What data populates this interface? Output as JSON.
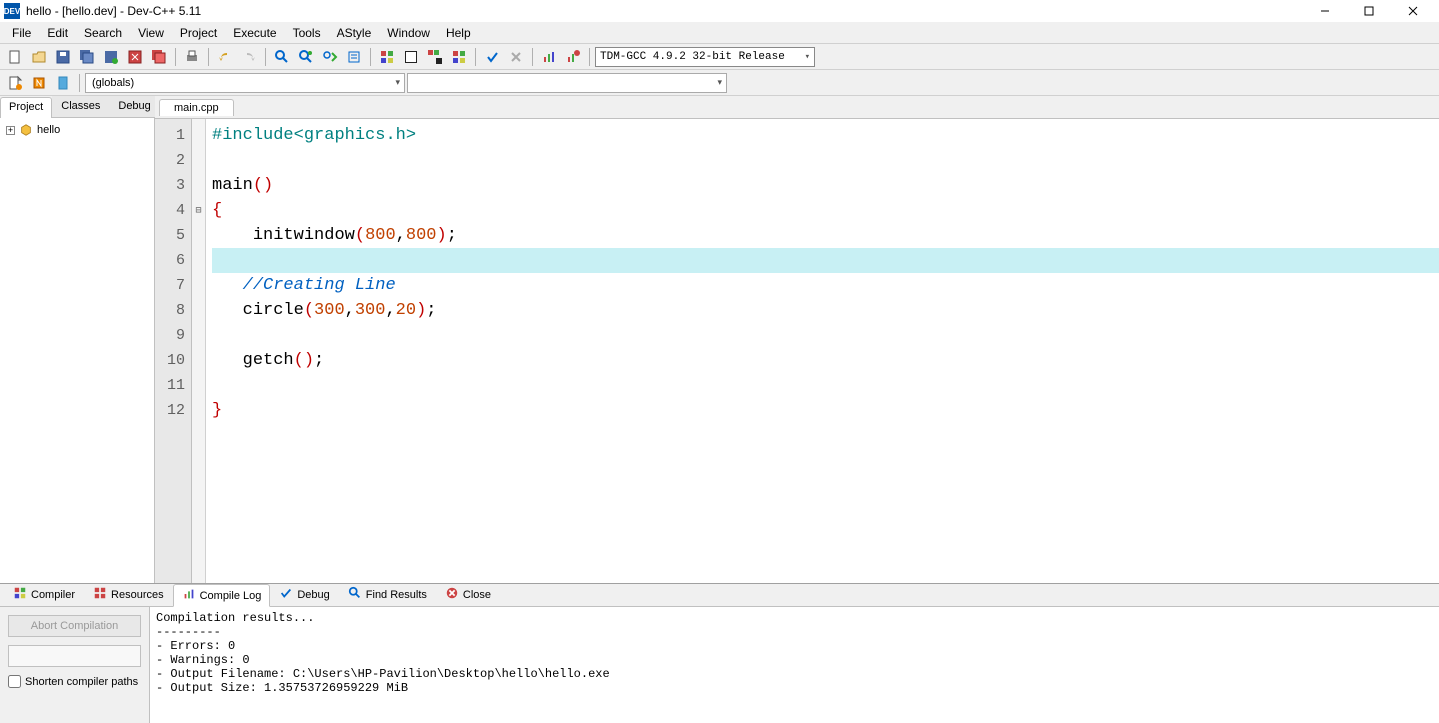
{
  "title": "hello - [hello.dev] - Dev-C++ 5.11",
  "menubar": [
    "File",
    "Edit",
    "Search",
    "View",
    "Project",
    "Execute",
    "Tools",
    "AStyle",
    "Window",
    "Help"
  ],
  "compiler_profile": "TDM-GCC 4.9.2 32-bit Release",
  "scope_combo": "(globals)",
  "left_tabs": [
    "Project",
    "Classes",
    "Debug"
  ],
  "left_tab_active": 0,
  "tree_root": "hello",
  "file_tab": "main.cpp",
  "line_count": 12,
  "highlight_line": 6,
  "fold_line": 4,
  "code": {
    "l1_include": "#include",
    "l1_header": "<graphics.h>",
    "l3_main": "main",
    "l5_fn": "initwindow",
    "l5_a": "800",
    "l5_b": "800",
    "l7_comment": "//Creating Line",
    "l8_fn": "circle",
    "l8_a": "300",
    "l8_b": "300",
    "l8_c": "20",
    "l10_fn": "getch"
  },
  "bottom_tabs": [
    {
      "label": "Compiler",
      "icon": "grid"
    },
    {
      "label": "Resources",
      "icon": "grid-red"
    },
    {
      "label": "Compile Log",
      "icon": "bars"
    },
    {
      "label": "Debug",
      "icon": "check"
    },
    {
      "label": "Find Results",
      "icon": "search"
    },
    {
      "label": "Close",
      "icon": "close"
    }
  ],
  "bottom_tab_active": 2,
  "abort_label": "Abort Compilation",
  "shorten_label": "Shorten compiler paths",
  "output": "Compilation results...\n---------\n- Errors: 0\n- Warnings: 0\n- Output Filename: C:\\Users\\HP-Pavilion\\Desktop\\hello\\hello.exe\n- Output Size: 1.35753726959229 MiB"
}
